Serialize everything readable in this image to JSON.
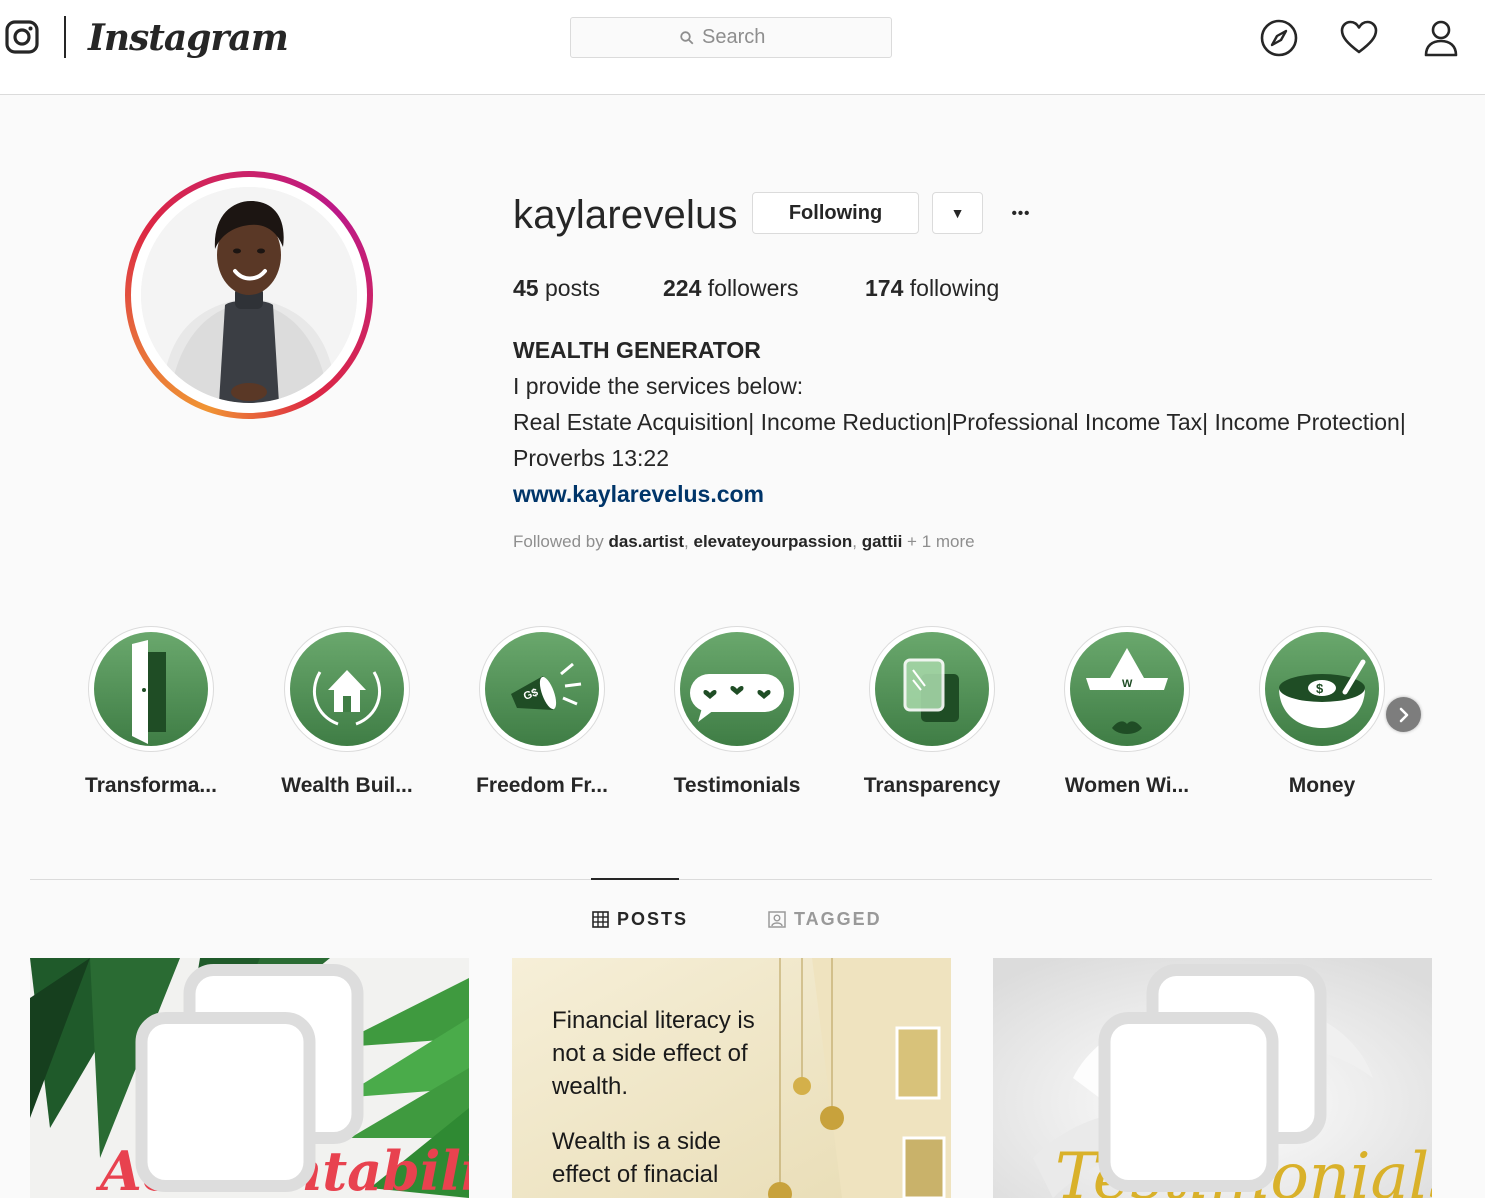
{
  "nav": {
    "brand": "Instagram",
    "search_placeholder": "Search",
    "icons": [
      "instagram-glyph-icon",
      "search-icon",
      "compass-icon",
      "heart-icon",
      "person-icon"
    ]
  },
  "profile": {
    "username": "kaylarevelus",
    "follow_button": "Following",
    "dropdown_glyph": "▼",
    "more_glyph": "•••",
    "stats": {
      "posts_count": "45",
      "posts_label": "posts",
      "followers_count": "224",
      "followers_label": "followers",
      "following_count": "174",
      "following_label": "following"
    },
    "bio": {
      "name": "WEALTH GENERATOR",
      "line1": "I provide the services below:",
      "line2": "Real Estate Acquisition| Income Reduction|Professional Income Tax| Income Protection|",
      "line3": "Proverbs 13:22",
      "link": "www.kaylarevelus.com"
    },
    "followed_by": {
      "prefix": "Followed by",
      "user1": "das.artist",
      "user2": "elevateyourpassion",
      "user3": "gattii",
      "suffix": "+ 1 more"
    }
  },
  "highlights": [
    {
      "label": "Transforma...",
      "icon": "door-icon"
    },
    {
      "label": "Wealth Buil...",
      "icon": "house-wreath-icon"
    },
    {
      "label": "Freedom Fr...",
      "icon": "megaphone-icon"
    },
    {
      "label": "Testimonials",
      "icon": "speech-hearts-icon"
    },
    {
      "label": "Transparency",
      "icon": "glass-panels-icon"
    },
    {
      "label": "Women Wi...",
      "icon": "crown-lips-icon"
    },
    {
      "label": "Money",
      "icon": "money-bowl-icon"
    }
  ],
  "tabs": [
    {
      "label": "POSTS",
      "active": true,
      "icon": "grid-icon"
    },
    {
      "label": "TAGGED",
      "active": false,
      "icon": "tagged-icon"
    }
  ],
  "posts": [
    {
      "overlay_text": "Accountability",
      "multi": true
    },
    {
      "overlay_text_1": "Financial literacy is",
      "overlay_text_2": "not a side effect of",
      "overlay_text_3": "wealth.",
      "overlay_text_4": "Wealth is a side",
      "overlay_text_5": "effect of finacial",
      "multi": false
    },
    {
      "overlay_text": "Testimonials",
      "multi": true
    }
  ],
  "colors": {
    "accent_green": "#5a9a5e",
    "link_blue": "#003569",
    "text": "#262626",
    "muted": "#8e8e8e",
    "border": "#dbdbdb"
  }
}
